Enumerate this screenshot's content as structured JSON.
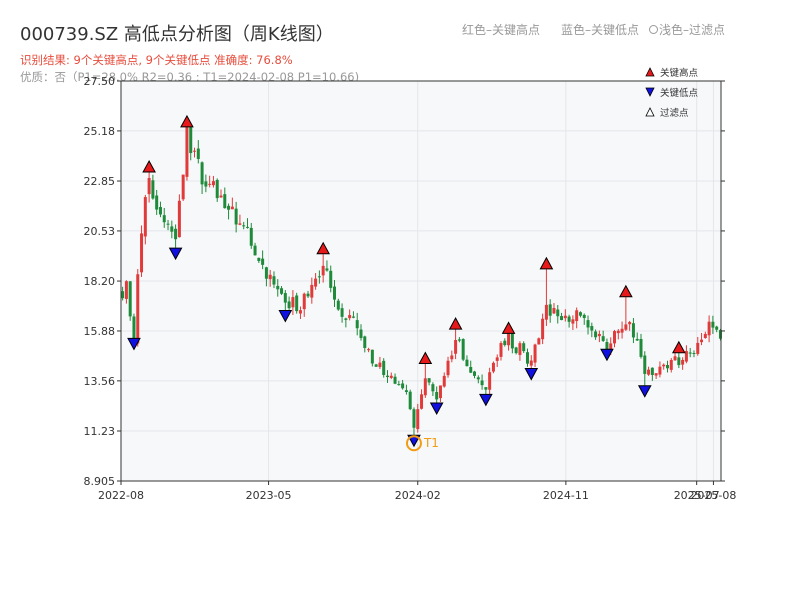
{
  "header": {
    "title": "000739.SZ 高低点分析图（周K线图）",
    "subtitle": "识别结果: 9个关键高点, 9个关键低点  准确度: 76.8%",
    "meta": "优质：否（P1=28.0%  R2=0.36 ; T1=2024-02-08 P1=10.66)",
    "legend_red": "红色–关键高点",
    "legend_blue": "蓝色–关键低点",
    "legend_filtered": "浅色–过滤点"
  },
  "chart_data": {
    "type": "candlestick",
    "title": "000739.SZ 高低点分析图（周K线图）",
    "y_ticks": [
      8.905,
      11.23,
      13.56,
      15.88,
      18.2,
      20.53,
      22.85,
      25.18,
      27.5
    ],
    "y_tick_labels": [
      "8.905",
      "11.23",
      "13.56",
      "15.88",
      "18.20",
      "20.53",
      "22.85",
      "25.18",
      "27.50"
    ],
    "ylim": [
      8.905,
      27.5
    ],
    "xlim": [
      "2022-08-01",
      "2025-08-15"
    ],
    "x_ticks": [
      "2022-08",
      "2023-05",
      "2024-02",
      "2024-11",
      "2025-07",
      "2025-08"
    ],
    "x_tick_dates": [
      "2022-08-01",
      "2023-05-01",
      "2024-02-01",
      "2024-11-01",
      "2025-07-01",
      "2025-08-01"
    ],
    "grid": true,
    "legend_position": "top-right",
    "legend": [
      "关键高点",
      "关键低点",
      "过滤点"
    ],
    "colors": {
      "up": "#e03a3a",
      "down": "#1e8a3a",
      "high_marker": "#e8191a",
      "low_marker": "#1010e0",
      "t1_marker": "#f39c12",
      "plot_bg": "#f7f8fa",
      "grid": "#e3e6ea"
    },
    "key_highs": [
      {
        "date": "2022-09-22",
        "value": 23.5
      },
      {
        "date": "2022-12-01",
        "value": 25.6
      },
      {
        "date": "2023-08-10",
        "value": 19.7
      },
      {
        "date": "2024-02-15",
        "value": 14.6
      },
      {
        "date": "2024-04-11",
        "value": 16.2
      },
      {
        "date": "2024-07-18",
        "value": 16.0
      },
      {
        "date": "2024-09-26",
        "value": 19.0
      },
      {
        "date": "2025-02-20",
        "value": 17.7
      },
      {
        "date": "2025-05-29",
        "value": 15.1
      }
    ],
    "key_lows": [
      {
        "date": "2022-08-25",
        "value": 15.3
      },
      {
        "date": "2022-11-10",
        "value": 19.5
      },
      {
        "date": "2023-06-01",
        "value": 16.6
      },
      {
        "date": "2024-01-25",
        "value": 10.8
      },
      {
        "date": "2024-03-07",
        "value": 12.3
      },
      {
        "date": "2024-06-06",
        "value": 12.7
      },
      {
        "date": "2024-08-29",
        "value": 13.9
      },
      {
        "date": "2025-01-16",
        "value": 14.8
      },
      {
        "date": "2025-03-27",
        "value": 13.1
      }
    ],
    "t1_point": {
      "label": "T1",
      "date": "2024-01-25",
      "value": 10.66
    },
    "price_path": [
      [
        "2022-08-01",
        17.5
      ],
      [
        "2022-08-11",
        18.2
      ],
      [
        "2022-08-25",
        15.5
      ],
      [
        "2022-09-08",
        20.8
      ],
      [
        "2022-09-22",
        22.8
      ],
      [
        "2022-10-13",
        21.5
      ],
      [
        "2022-11-10",
        20.0
      ],
      [
        "2022-12-01",
        25.0
      ],
      [
        "2022-12-29",
        23.0
      ],
      [
        "2023-01-26",
        22.3
      ],
      [
        "2023-02-23",
        21.5
      ],
      [
        "2023-03-30",
        20.0
      ],
      [
        "2023-04-27",
        18.5
      ],
      [
        "2023-05-25",
        17.5
      ],
      [
        "2023-06-22",
        17.0
      ],
      [
        "2023-07-20",
        17.8
      ],
      [
        "2023-08-10",
        19.0
      ],
      [
        "2023-09-07",
        17.0
      ],
      [
        "2023-10-12",
        16.3
      ],
      [
        "2023-11-09",
        14.5
      ],
      [
        "2023-12-07",
        13.8
      ],
      [
        "2024-01-11",
        13.0
      ],
      [
        "2024-01-25",
        11.2
      ],
      [
        "2024-02-15",
        13.8
      ],
      [
        "2024-03-07",
        12.8
      ],
      [
        "2024-04-11",
        15.5
      ],
      [
        "2024-05-09",
        14.2
      ],
      [
        "2024-06-06",
        13.2
      ],
      [
        "2024-06-27",
        14.8
      ],
      [
        "2024-07-18",
        15.5
      ],
      [
        "2024-08-29",
        14.5
      ],
      [
        "2024-09-26",
        17.0
      ],
      [
        "2024-10-24",
        16.2
      ],
      [
        "2024-11-21",
        16.5
      ],
      [
        "2024-12-19",
        15.8
      ],
      [
        "2025-01-16",
        15.2
      ],
      [
        "2025-02-20",
        16.5
      ],
      [
        "2025-03-13",
        15.3
      ],
      [
        "2025-03-27",
        13.8
      ],
      [
        "2025-04-24",
        14.1
      ],
      [
        "2025-05-29",
        14.5
      ],
      [
        "2025-06-26",
        15.0
      ],
      [
        "2025-07-24",
        16.2
      ],
      [
        "2025-08-14",
        15.8
      ]
    ]
  }
}
